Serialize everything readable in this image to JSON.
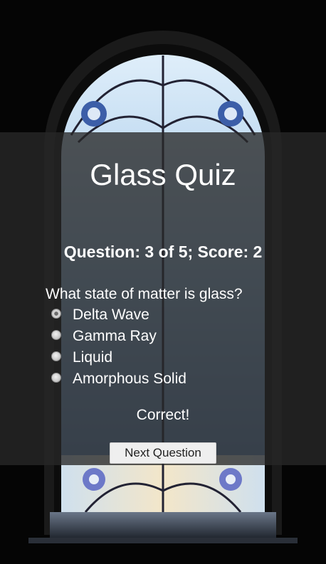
{
  "quiz": {
    "title": "Glass Quiz",
    "status": "Question: 3 of 5; Score: 2",
    "question": "What state of matter is glass?",
    "options": [
      {
        "label": "Delta Wave",
        "selected": true
      },
      {
        "label": "Gamma Ray",
        "selected": false
      },
      {
        "label": "Liquid",
        "selected": false
      },
      {
        "label": "Amorphous Solid",
        "selected": false
      }
    ],
    "feedback": "Correct!",
    "next_label": "Next Question"
  }
}
